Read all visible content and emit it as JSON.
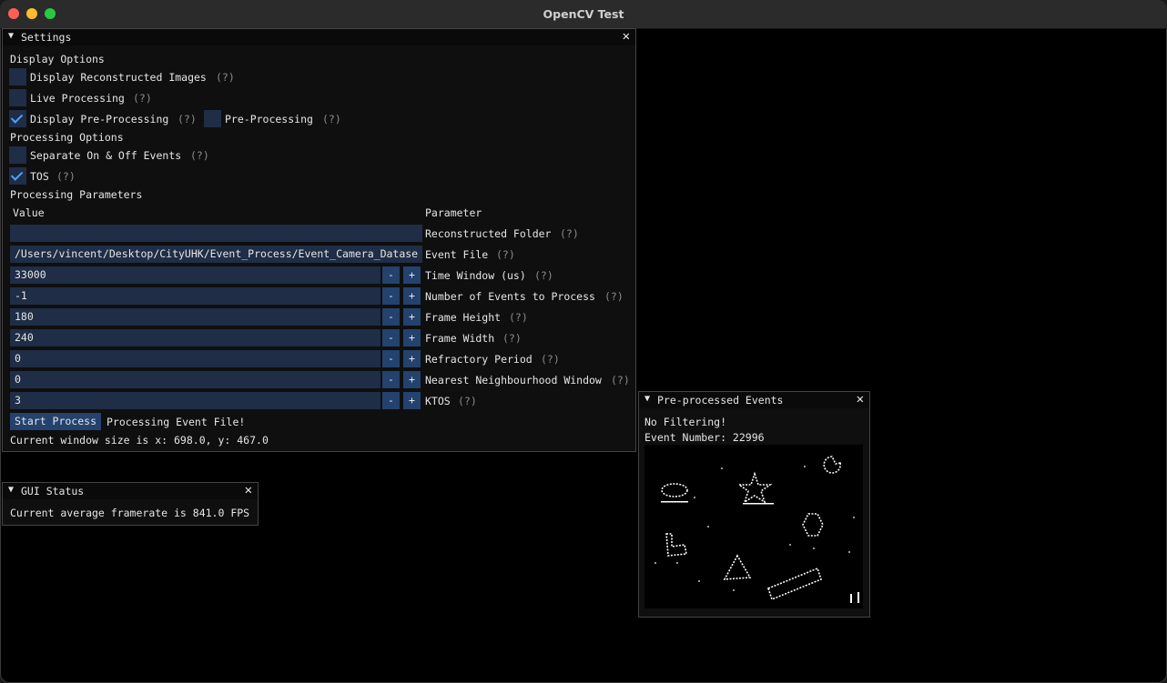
{
  "window": {
    "title": "OpenCV Test"
  },
  "settings": {
    "title": "Settings",
    "close": "✕",
    "display_options_header": "Display Options",
    "display_reconstructed": {
      "label": "Display Reconstructed Images",
      "help": "(?)",
      "checked": false
    },
    "live_processing": {
      "label": "Live Processing",
      "help": "(?)",
      "checked": false
    },
    "display_preprocessing": {
      "label": "Display Pre-Processing",
      "help": "(?)",
      "checked": true
    },
    "preprocessing": {
      "label": "Pre-Processing",
      "help": "(?)",
      "checked": false
    },
    "processing_options_header": "Processing Options",
    "separate_events": {
      "label": "Separate On & Off Events",
      "help": "(?)",
      "checked": false
    },
    "tos": {
      "label": "TOS",
      "help": "(?)",
      "checked": true
    },
    "processing_parameters_header": "Processing Parameters",
    "col_value": "Value",
    "col_parameter": "Parameter",
    "params": [
      {
        "value": "",
        "label": "Reconstructed Folder",
        "help": "(?)",
        "stepper": false
      },
      {
        "value": "/Users/vincent/Desktop/CityUHK/Event_Process/Event_Camera_Datase",
        "label": "Event File",
        "help": "(?)",
        "stepper": false
      },
      {
        "value": "33000",
        "label": "Time Window (us)",
        "help": "(?)",
        "stepper": true
      },
      {
        "value": "-1",
        "label": "Number of Events to Process",
        "help": "(?)",
        "stepper": true
      },
      {
        "value": "180",
        "label": "Frame Height",
        "help": "(?)",
        "stepper": true
      },
      {
        "value": "240",
        "label": "Frame Width",
        "help": "(?)",
        "stepper": true
      },
      {
        "value": "0",
        "label": "Refractory Period",
        "help": "(?)",
        "stepper": true
      },
      {
        "value": "0",
        "label": "Nearest Neighbourhood Window",
        "help": "(?)",
        "stepper": true
      },
      {
        "value": "3",
        "label": "KTOS",
        "help": "(?)",
        "stepper": true
      }
    ],
    "minus": "-",
    "plus": "+",
    "start_button": "Start Process",
    "status_text": "Processing Event File!",
    "window_size_text": "Current window size is x: 698.0, y: 467.0"
  },
  "gui_status": {
    "title": "GUI Status",
    "close": "✕",
    "framerate_text": "Current average framerate is 841.0 FPS"
  },
  "preprocessed": {
    "title": "Pre-processed Events",
    "close": "✕",
    "filter_text": "No Filtering!",
    "event_number_text": "Event Number: 22996"
  },
  "colors": {
    "accent": "#4da3ff",
    "frame_bg": "#1f2d46",
    "button_bg": "#23426e"
  }
}
